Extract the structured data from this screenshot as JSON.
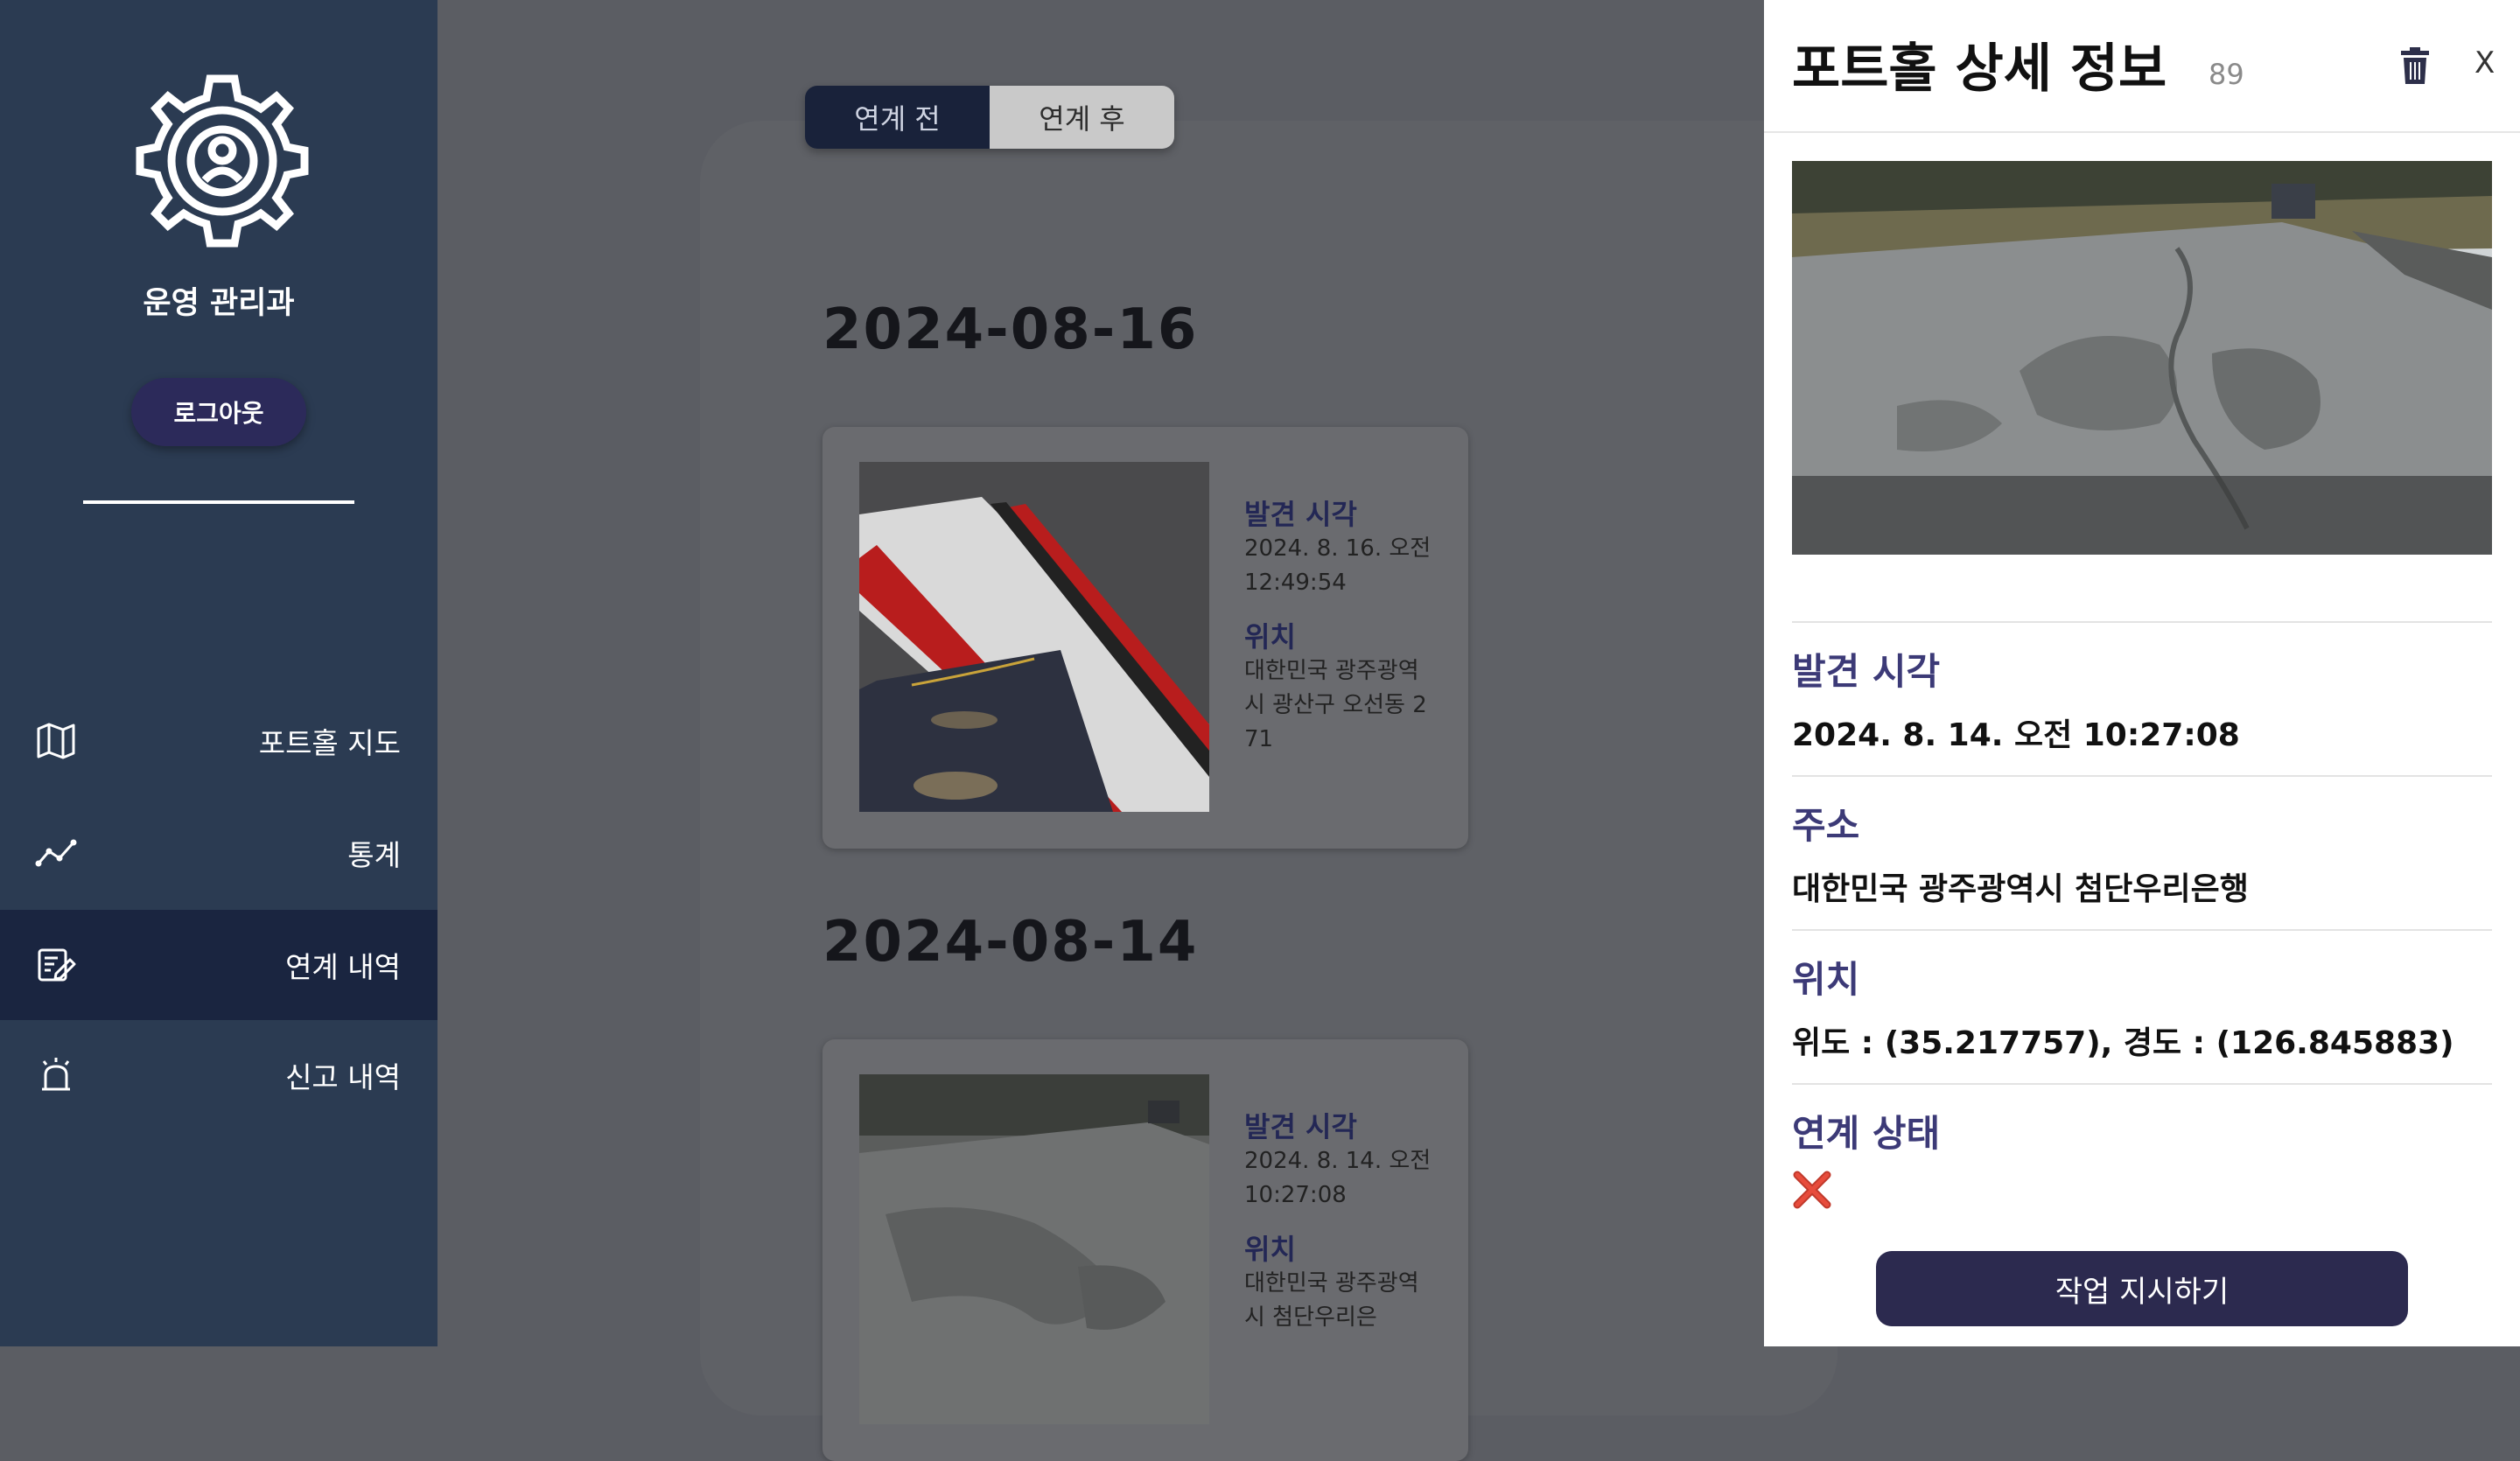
{
  "sidebar": {
    "org_name": "운영 관리과",
    "logout_label": "로그아웃",
    "items": [
      {
        "label": "포트홀 지도",
        "icon": "map-icon"
      },
      {
        "label": "통계",
        "icon": "line-chart-icon"
      },
      {
        "label": "연계 내역",
        "icon": "edit-note-icon",
        "active": true
      },
      {
        "label": "신고 내역",
        "icon": "siren-icon"
      }
    ]
  },
  "main": {
    "toggle": {
      "before": "연계 전",
      "after": "연계 후",
      "selected": "연계 전"
    },
    "groups": [
      {
        "date": "2024-08-16",
        "card": {
          "time_label": "발견 시각",
          "time_value": "2024. 8. 16. 오전 12:49:54",
          "location_label": "위치",
          "location_value": "대한민국 광주광역시 광산구 오선동 271"
        }
      },
      {
        "date": "2024-08-14",
        "card": {
          "time_label": "발견 시각",
          "time_value": "2024. 8. 14. 오전 10:27:08",
          "location_label": "위치",
          "location_value": "대한민국 광주광역시 첨단우리은"
        }
      }
    ]
  },
  "drawer": {
    "title": "포트홀 상세 정보",
    "count": "89",
    "close_label": "X",
    "time_label": "발견 시각",
    "time_value": "2024. 8. 14. 오전 10:27:08",
    "address_label": "주소",
    "address_value": "대한민국 광주광역시 첨단우리은행",
    "location_label": "위치",
    "location_value": "위도 : (35.217757), 경도 : (126.845883)",
    "status_label": "연계 상태",
    "status_icon": "cross-mark-icon",
    "action_label": "작업 지시하기"
  },
  "colors": {
    "sidebar_bg": "#2b3b52",
    "sidebar_active": "#1a2540",
    "brand_dark": "#2c2a4f",
    "label_purple": "#3c3a77",
    "status_red": "#c0392b"
  }
}
